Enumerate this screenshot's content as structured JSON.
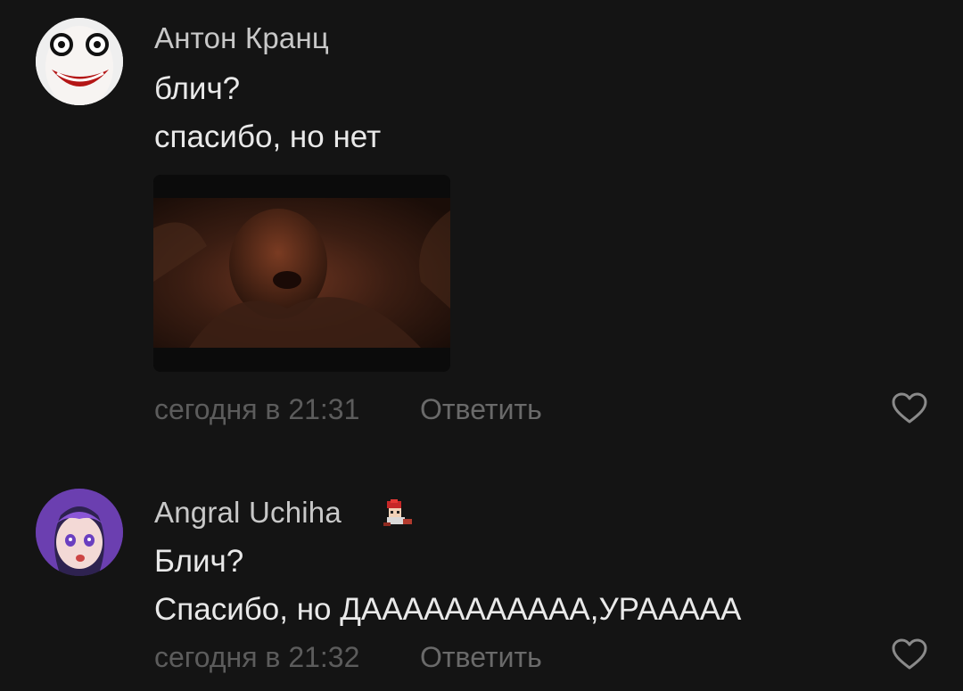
{
  "comments": [
    {
      "author": "Антон Кранц",
      "lines": [
        "блич?",
        "спасибо, но нет"
      ],
      "timestamp": "сегодня в 21:31",
      "reply_label": "Ответить",
      "has_media": true,
      "avatar_icon": "creepy-face-avatar",
      "like_icon": "heart-outline-icon"
    },
    {
      "author": "Angral Uchiha",
      "author_badge_icon": "pixel-character-badge-icon",
      "lines": [
        "Блич?",
        "Спасибо, но ДААААААААААА,УРААААА"
      ],
      "timestamp": "сегодня в 21:32",
      "reply_label": "Ответить",
      "has_media": false,
      "avatar_icon": "anime-girl-avatar",
      "like_icon": "heart-outline-icon"
    }
  ],
  "colors": {
    "background": "#141414",
    "author": "#c8c8c8",
    "text": "#e9e9e9",
    "meta": "#5c5c5c"
  }
}
